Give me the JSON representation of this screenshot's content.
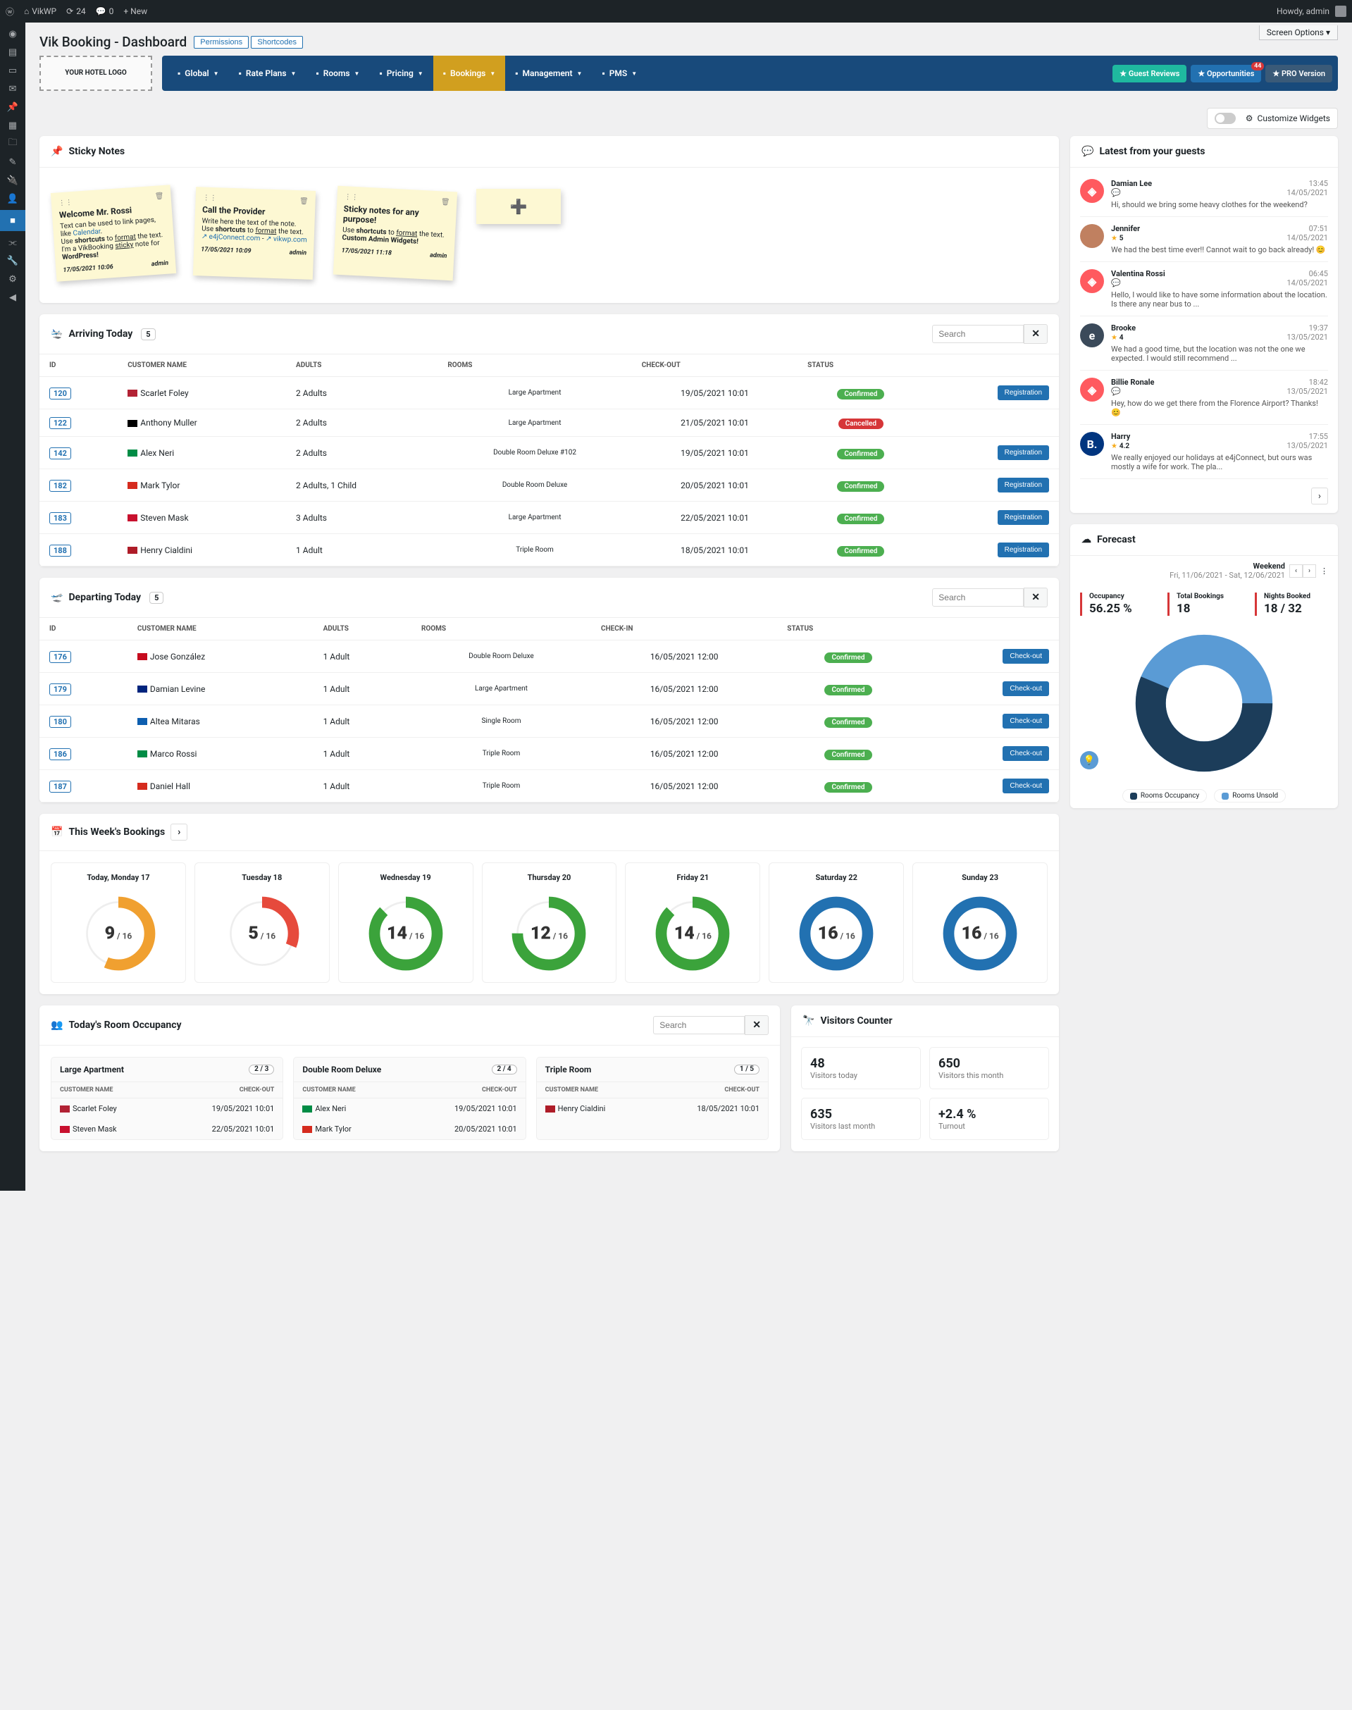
{
  "admin_bar": {
    "site": "VikWP",
    "updates": "24",
    "comments": "0",
    "new": "+ New",
    "howdy": "Howdy, admin"
  },
  "screen_options": "Screen Options ▾",
  "page_title": "Vik Booking - Dashboard",
  "page_buttons": [
    "Permissions",
    "Shortcodes"
  ],
  "logo_text": "YOUR HOTEL LOGO",
  "nav": [
    "Global",
    "Rate Plans",
    "Rooms",
    "Pricing",
    "Bookings",
    "Management",
    "PMS"
  ],
  "nav_active_index": 4,
  "nav_right": [
    {
      "label": "Guest Reviews",
      "color": "#1fb99f"
    },
    {
      "label": "Opportunities",
      "color": "#2271b1",
      "badge": "44"
    },
    {
      "label": "PRO Version",
      "color": "#3a5a78"
    }
  ],
  "customize_label": "Customize Widgets",
  "sticky": {
    "title": "Sticky Notes",
    "notes": [
      {
        "title": "Welcome Mr. Rossi",
        "body_html": "Text can be used to link pages, like <span class='sticky-link'>Calendar</span>.<br>Use <b>shortcuts</b> to <u>format</u> the text.<br>I'm a VikBooking <u>sticky</u> note for <b>WordPress!</b>",
        "date": "17/05/2021 10:06",
        "author": "admin"
      },
      {
        "title": "Call the Provider",
        "body_html": "Write here the text of the note.<br>Use <b>shortcuts</b> to <u>format</u> the text.<br><span class='sticky-link'>↗ e4jConnect.com</span> - <span class='sticky-link'>↗ vikwp.com</span>",
        "date": "17/05/2021 10:09",
        "author": "admin"
      },
      {
        "title": "Sticky notes for any purpose!",
        "body_html": "Use <b>shortcuts</b> to <u>format</u> the text.<br><b>Custom Admin Widgets!</b>",
        "date": "17/05/2021 11:18",
        "author": "admin"
      }
    ]
  },
  "arriving": {
    "title": "Arriving Today",
    "count": "5",
    "search_ph": "Search",
    "headers": [
      "ID",
      "CUSTOMER NAME",
      "ADULTS",
      "ROOMS",
      "CHECK-OUT",
      "STATUS",
      ""
    ],
    "rows": [
      {
        "id": "120",
        "flag": "#b22234",
        "name": "Scarlet Foley",
        "adults": "2 Adults",
        "room": "Large Apartment",
        "checkout": "19/05/2021 10:01",
        "status": "Confirmed",
        "action": "Registration"
      },
      {
        "id": "122",
        "flag": "#000",
        "name": "Anthony Muller",
        "adults": "2 Adults",
        "room": "Large Apartment",
        "checkout": "21/05/2021 10:01",
        "status": "Cancelled",
        "action": ""
      },
      {
        "id": "142",
        "flag": "#008c45",
        "name": "Alex Neri",
        "adults": "2 Adults",
        "room": "Double Room Deluxe #102",
        "checkout": "19/05/2021 10:01",
        "status": "Confirmed",
        "action": "Registration"
      },
      {
        "id": "182",
        "flag": "#d52b1e",
        "name": "Mark Tylor",
        "adults": "2 Adults, 1 Child",
        "room": "Double Room Deluxe",
        "checkout": "20/05/2021 10:01",
        "status": "Confirmed",
        "action": "Registration"
      },
      {
        "id": "183",
        "flag": "#c8102e",
        "name": "Steven Mask",
        "adults": "3 Adults",
        "room": "Large Apartment",
        "checkout": "22/05/2021 10:01",
        "status": "Confirmed",
        "action": "Registration"
      },
      {
        "id": "188",
        "flag": "#ae1c28",
        "name": "Henry Cialdini",
        "adults": "1 Adult",
        "room": "Triple Room",
        "checkout": "18/05/2021 10:01",
        "status": "Confirmed",
        "action": "Registration"
      }
    ]
  },
  "departing": {
    "title": "Departing Today",
    "count": "5",
    "search_ph": "Search",
    "headers": [
      "ID",
      "CUSTOMER NAME",
      "ADULTS",
      "ROOMS",
      "CHECK-IN",
      "STATUS",
      ""
    ],
    "rows": [
      {
        "id": "176",
        "flag": "#c60b1e",
        "name": "Jose González",
        "adults": "1 Adult",
        "room": "Double Room Deluxe",
        "checkin": "16/05/2021 12:00",
        "status": "Confirmed",
        "action": "Check-out"
      },
      {
        "id": "179",
        "flag": "#00247d",
        "name": "Damian Levine",
        "adults": "1 Adult",
        "room": "Large Apartment",
        "checkin": "16/05/2021 12:00",
        "status": "Confirmed",
        "action": "Check-out"
      },
      {
        "id": "180",
        "flag": "#0d5eaf",
        "name": "Altea Mitaras",
        "adults": "1 Adult",
        "room": "Single Room",
        "checkin": "16/05/2021 12:00",
        "status": "Confirmed",
        "action": "Check-out"
      },
      {
        "id": "186",
        "flag": "#008c45",
        "name": "Marco Rossi",
        "adults": "1 Adult",
        "room": "Triple Room",
        "checkin": "16/05/2021 12:00",
        "status": "Confirmed",
        "action": "Check-out"
      },
      {
        "id": "187",
        "flag": "#d52b1e",
        "name": "Daniel Hall",
        "adults": "1 Adult",
        "room": "Triple Room",
        "checkin": "16/05/2021 12:00",
        "status": "Confirmed",
        "action": "Check-out"
      }
    ]
  },
  "guests": {
    "title": "Latest from your guests",
    "items": [
      {
        "avatar_bg": "#ff5a5f",
        "avatar_txt": "◈",
        "name": "Damian Lee",
        "icon": "chat",
        "time": "13:45",
        "date": "14/05/2021",
        "text": "Hi, should we bring some heavy clothes for the weekend?"
      },
      {
        "avatar_bg": "#c08060",
        "avatar_txt": "",
        "name": "Jennifer",
        "rating": "5",
        "time": "07:51",
        "date": "14/05/2021",
        "text": "We had the best time ever!! Cannot wait to go back already! 😊"
      },
      {
        "avatar_bg": "#ff5a5f",
        "avatar_txt": "◈",
        "name": "Valentina Rossi",
        "icon": "chat",
        "time": "06:45",
        "date": "14/05/2021",
        "text": "Hello, I would like to have some information about the location. Is there any near bus to ..."
      },
      {
        "avatar_bg": "#3b4a5a",
        "avatar_txt": "e",
        "name": "Brooke",
        "rating": "4",
        "time": "19:37",
        "date": "13/05/2021",
        "text": "We had a good time, but the location was not the one we expected. I would still recommend ..."
      },
      {
        "avatar_bg": "#ff5a5f",
        "avatar_txt": "◈",
        "name": "Billie Ronale",
        "icon": "chat",
        "time": "18:42",
        "date": "13/05/2021",
        "text": "Hey, how do we get there from the Florence Airport? Thanks! 😊"
      },
      {
        "avatar_bg": "#00357f",
        "avatar_txt": "B.",
        "name": "Harry",
        "rating": "4.2",
        "time": "17:55",
        "date": "13/05/2021",
        "text": "We really enjoyed our holidays at e4jConnect, but ours was mostly a wife for work. The pla..."
      }
    ]
  },
  "forecast": {
    "title": "Forecast",
    "period_title": "Weekend",
    "period_range": "Fri, 11/06/2021 - Sat, 12/06/2021",
    "kpis": [
      {
        "label": "Occupancy",
        "value": "56.25 %"
      },
      {
        "label": "Total Bookings",
        "value": "18"
      },
      {
        "label": "Nights Booked",
        "value": "18 / 32"
      }
    ],
    "legend": [
      {
        "label": "Rooms Occupancy",
        "color": "#1c3d5a"
      },
      {
        "label": "Rooms Unsold",
        "color": "#5a9bd5"
      }
    ]
  },
  "chart_data": {
    "type": "pie",
    "title": "Forecast Occupancy",
    "series": [
      {
        "name": "Rooms Occupancy",
        "value": 56.25,
        "color": "#1c3d5a"
      },
      {
        "name": "Rooms Unsold",
        "value": 43.75,
        "color": "#5a9bd5"
      }
    ]
  },
  "week": {
    "title": "This Week's Bookings",
    "days": [
      {
        "label": "Today, Monday 17",
        "booked": 9,
        "total": 16,
        "color": "#f0a030"
      },
      {
        "label": "Tuesday 18",
        "booked": 5,
        "total": 16,
        "color": "#e64a3c"
      },
      {
        "label": "Wednesday 19",
        "booked": 14,
        "total": 16,
        "color": "#3ba33b"
      },
      {
        "label": "Thursday 20",
        "booked": 12,
        "total": 16,
        "color": "#3ba33b"
      },
      {
        "label": "Friday 21",
        "booked": 14,
        "total": 16,
        "color": "#3ba33b"
      },
      {
        "label": "Saturday 22",
        "booked": 16,
        "total": 16,
        "color": "#2271b1"
      },
      {
        "label": "Sunday 23",
        "booked": 16,
        "total": 16,
        "color": "#2271b1"
      }
    ]
  },
  "occupancy": {
    "title": "Today's Room Occupancy",
    "search_ph": "Search",
    "col_name": "CUSTOMER NAME",
    "col_out": "CHECK-OUT",
    "rooms": [
      {
        "name": "Large Apartment",
        "ratio": "2 / 3",
        "guests": [
          {
            "flag": "#b22234",
            "name": "Scarlet Foley",
            "out": "19/05/2021 10:01"
          },
          {
            "flag": "#c8102e",
            "name": "Steven Mask",
            "out": "22/05/2021 10:01"
          }
        ]
      },
      {
        "name": "Double Room Deluxe",
        "ratio": "2 / 4",
        "guests": [
          {
            "flag": "#008c45",
            "name": "Alex Neri",
            "out": "19/05/2021 10:01"
          },
          {
            "flag": "#d52b1e",
            "name": "Mark Tylor",
            "out": "20/05/2021 10:01"
          }
        ]
      },
      {
        "name": "Triple Room",
        "ratio": "1 / 5",
        "guests": [
          {
            "flag": "#ae1c28",
            "name": "Henry Cialdini",
            "out": "18/05/2021 10:01"
          }
        ]
      }
    ]
  },
  "visitors": {
    "title": "Visitors Counter",
    "boxes": [
      {
        "value": "48",
        "label": "Visitors today"
      },
      {
        "value": "650",
        "label": "Visitors this month"
      },
      {
        "value": "635",
        "label": "Visitors last month"
      },
      {
        "value": "+2.4 %",
        "label": "Turnout"
      }
    ]
  }
}
